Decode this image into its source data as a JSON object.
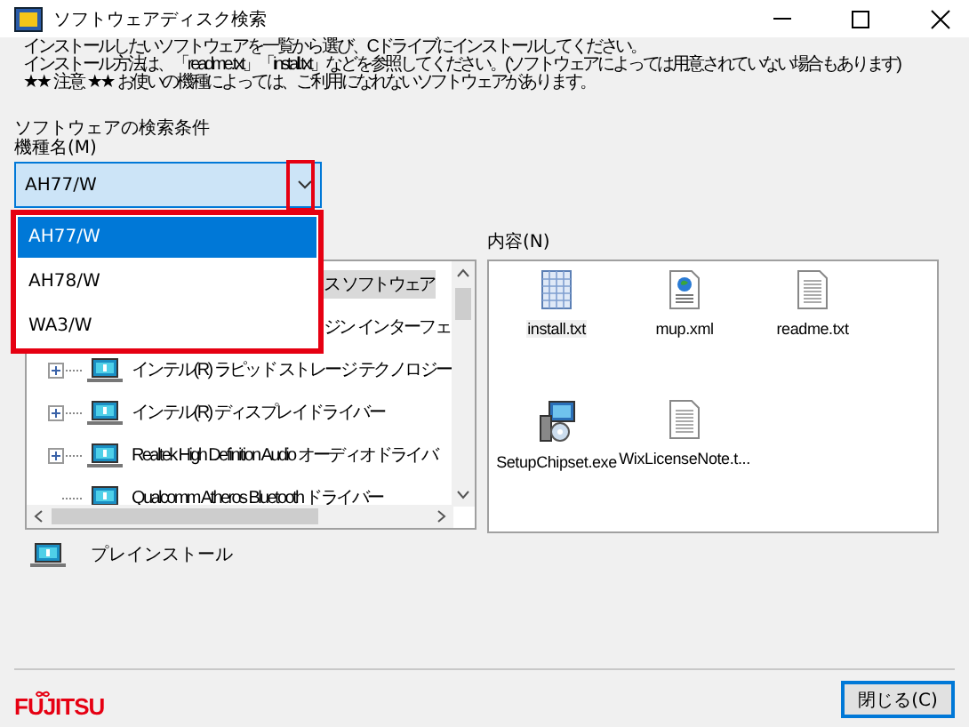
{
  "window": {
    "title": "ソフトウェアディスク検索"
  },
  "instructions": [
    "インストールしたいソフトウェアを一覧から選び、Cドライブにインストールしてください。",
    "インストール方法は、「readme.txt」「install.txt」などを参照してください。(ソフトウェアによっては用意されていない場合もあります)",
    "★★ 注意 ★★ お使いの機種によっては、ご利用になれないソフトウェアがあります。"
  ],
  "search": {
    "heading": "ソフトウェアの検索条件",
    "model_label": "機種名(M)",
    "model_value": "AH77/W",
    "expanded": true,
    "options": [
      {
        "label": "AH77/W",
        "selected": true
      },
      {
        "label": "AH78/W",
        "selected": false
      },
      {
        "label": "WA3/W",
        "selected": false
      }
    ]
  },
  "tree": {
    "items": [
      {
        "kind": "covered",
        "label": "ス ソフトウェア",
        "selected": true
      },
      {
        "kind": "covered",
        "label": "ジン インターフェ",
        "selected": false
      },
      {
        "kind": "node",
        "label": "インテル(R) ラピッド ストレージ テクノロジー",
        "selected": false,
        "expandable": true
      },
      {
        "kind": "node",
        "label": "インテル(R) ディスプレイドライバー",
        "selected": false,
        "expandable": true
      },
      {
        "kind": "node",
        "label": "Realtek High Definition Audio オーディオドライバ",
        "selected": false,
        "expandable": true
      },
      {
        "kind": "node",
        "label": "Qualcomm Atheros Bluetooth ドライバー",
        "selected": false,
        "expandable": false
      }
    ]
  },
  "contents": {
    "label": "内容(N)",
    "files": [
      {
        "name": "install.txt",
        "kind": "grid",
        "selected": true
      },
      {
        "name": "mup.xml",
        "kind": "web",
        "selected": false
      },
      {
        "name": "readme.txt",
        "kind": "text",
        "selected": false
      },
      {
        "name": "SetupChipset.exe",
        "kind": "installer",
        "selected": false
      },
      {
        "name": "WixLicenseNote.t...",
        "kind": "text",
        "selected": false
      }
    ]
  },
  "legend": {
    "label": "プレインストール"
  },
  "footer": {
    "logo": "FUJITSU",
    "close_button": "閉じる(C)"
  }
}
